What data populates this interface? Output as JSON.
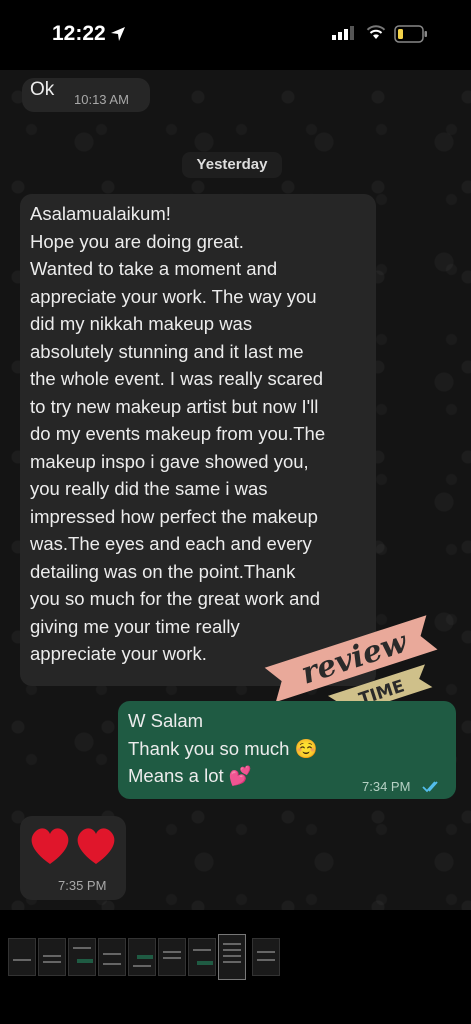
{
  "status": {
    "time": "12:22"
  },
  "messages": {
    "ok": {
      "text": "Ok",
      "time": "10:13 AM"
    },
    "date_divider": "Yesterday",
    "review": {
      "text": "Asalamualaikum!\nHope you are doing great.\nWanted to take a moment and\nappreciate your work. The way you\ndid my nikkah makeup was\nabsolutely stunning and it last me\nthe whole event. I was really scared\nto try new makeup artist but now I'll\ndo my events makeup from you.The\nmakeup inspo i gave showed you,\nyou really did the same i was\nimpressed how perfect the makeup\nwas.The eyes and each and every\ndetailing was on the point.Thank\nyou so much for the great work and\ngiving me your time really\nappreciate your work."
    },
    "reply": {
      "text": "W Salam\nThank you so much ☺️\nMeans a lot 💕",
      "time": "7:34 PM"
    },
    "hearts": {
      "text": "❤️❤️",
      "time": "7:35 PM"
    }
  },
  "sticker": {
    "word1": "review",
    "word2": "TIME"
  },
  "colors": {
    "incoming": "#262626",
    "outgoing": "#1f5b43",
    "sticker_pink": "#e9a99a",
    "sticker_tan": "#cfc08a"
  }
}
